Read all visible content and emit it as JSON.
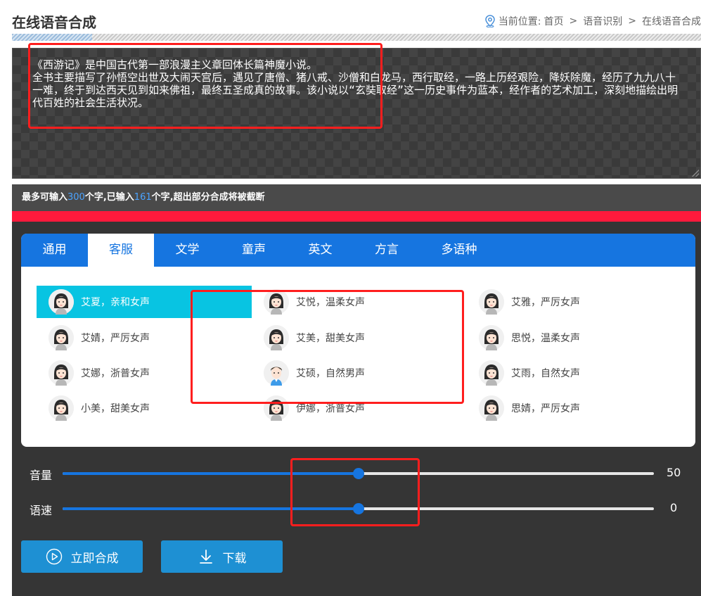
{
  "header": {
    "title": "在线语音合成",
    "breadcrumb": {
      "prefix": "当前位置:",
      "items": [
        "首页",
        "语音识别",
        "在线语音合成"
      ],
      "separator": ">"
    }
  },
  "editor": {
    "text": "《西游记》是中国古代第一部浪漫主义章回体长篇神魔小说。\n全书主要描写了孙悟空出世及大闹天宫后，遇见了唐僧、猪八戒、沙僧和白龙马，西行取经，一路上历经艰险，降妖除魔，经历了九九八十一难，终于到达西天见到如来佛祖，最终五圣成真的故事。该小说以“玄奘取经”这一历史事件为蓝本，经作者的艺术加工，深刻地描绘出明代百姓的社会生活状况。"
  },
  "info": {
    "part1": "最多可输入",
    "max": "300",
    "part2": "个字,已输入",
    "count": "161",
    "part3": "个字,超出部分合成将被截断"
  },
  "tabs": [
    {
      "label": "通用"
    },
    {
      "label": "客服"
    },
    {
      "label": "文学"
    },
    {
      "label": "童声"
    },
    {
      "label": "英文"
    },
    {
      "label": "方言"
    },
    {
      "label": "多语种"
    }
  ],
  "active_tab": 1,
  "voices": [
    {
      "label": "艾夏，亲和女声",
      "avatar": "female-avatar-icon"
    },
    {
      "label": "艾悦，温柔女声",
      "avatar": "female-avatar-icon"
    },
    {
      "label": "艾雅，严厉女声",
      "avatar": "female-avatar-icon"
    },
    {
      "label": "艾婧，严厉女声",
      "avatar": "female-avatar-icon"
    },
    {
      "label": "艾美，甜美女声",
      "avatar": "female-avatar-icon"
    },
    {
      "label": "思悦，温柔女声",
      "avatar": "female-avatar-icon"
    },
    {
      "label": "艾娜，浙普女声",
      "avatar": "female-avatar-icon"
    },
    {
      "label": "艾硕，自然男声",
      "avatar": "male-avatar-icon"
    },
    {
      "label": "艾雨，自然女声",
      "avatar": "female-avatar-icon"
    },
    {
      "label": "小美，甜美女声",
      "avatar": "female-avatar-icon"
    },
    {
      "label": "伊娜，浙普女声",
      "avatar": "female-avatar-icon"
    },
    {
      "label": "思婧，严厉女声",
      "avatar": "female-avatar-icon"
    }
  ],
  "selected_voice": 0,
  "sliders": {
    "volume": {
      "label": "音量",
      "value": "50",
      "fill_fraction": 0.5
    },
    "speed": {
      "label": "语速",
      "value": "0",
      "fill_fraction": 0.5
    }
  },
  "buttons": {
    "synthesize": "立即合成",
    "download": "下载"
  },
  "colors": {
    "accent": "#1675e0",
    "selected": "#08c4e2",
    "button": "#1e90d3",
    "alert_bar": "#ff1a3c",
    "annotation": "#ff1e1e"
  }
}
